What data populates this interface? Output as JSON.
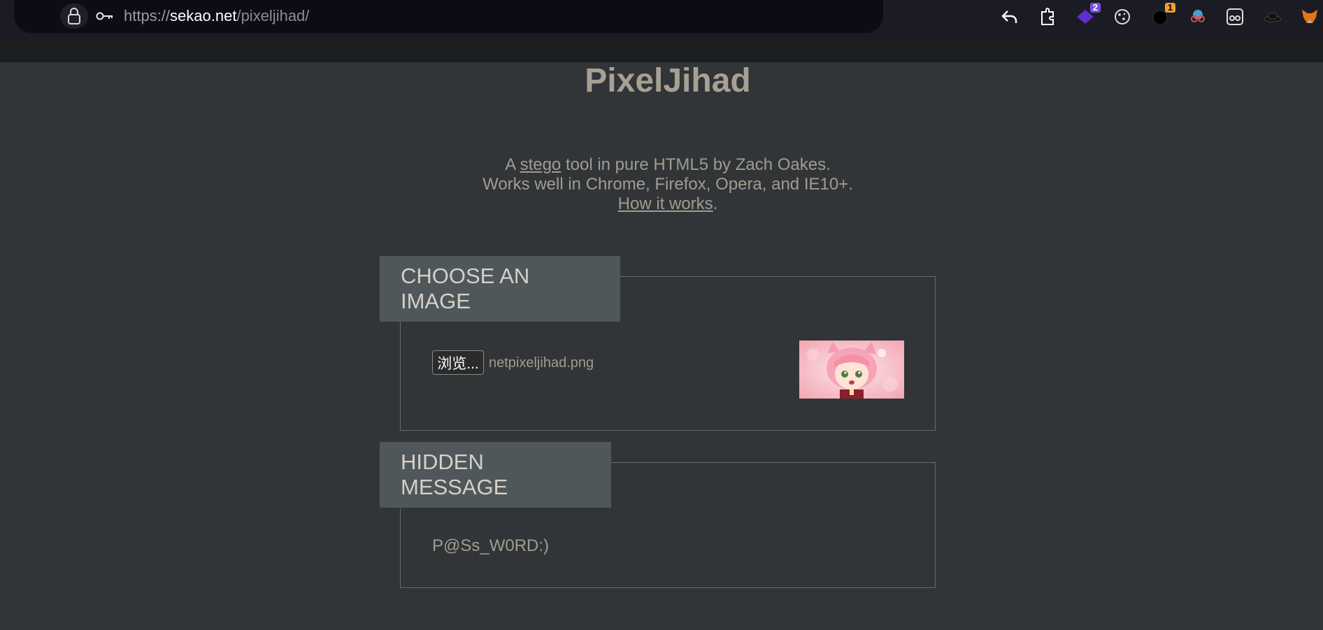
{
  "browser": {
    "url_protocol": "https://",
    "url_host": "sekao.net",
    "url_path": "/pixeljihad/",
    "badges": {
      "extension_purple": "2",
      "extension_timer": "1"
    }
  },
  "page": {
    "title": "PixelJihad",
    "intro": {
      "line1_prefix": "A ",
      "line1_link": "stego",
      "line1_suffix": " tool in pure HTML5 by Zach Oakes.",
      "line2": "Works well in Chrome, Firefox, Opera, and IE10+.",
      "line3_link": "How it works",
      "line3_suffix": "."
    },
    "choose_image": {
      "legend": "CHOOSE AN IMAGE",
      "browse_label": "浏览...",
      "filename": "netpixeljihad.png"
    },
    "hidden_message": {
      "legend": "HIDDEN MESSAGE",
      "text": "P@Ss_W0RD:)"
    }
  },
  "colors": {
    "page_bg": "#313538",
    "legend_bg": "#4f575a",
    "text": "#a29b90",
    "title": "#a8a094"
  }
}
